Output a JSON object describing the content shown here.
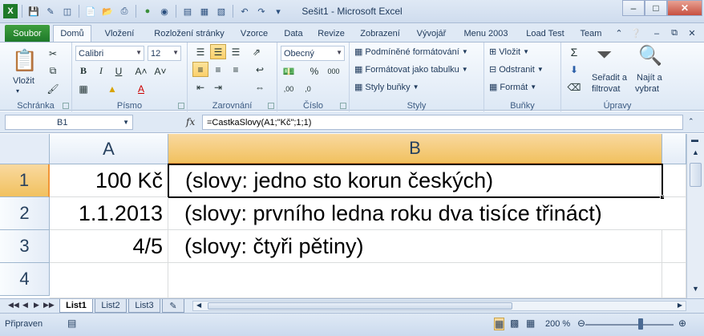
{
  "window": {
    "title": "Sešit1 - Microsoft Excel"
  },
  "ribbon": {
    "tabs": [
      "Soubor",
      "Domů",
      "Vložení",
      "Rozložení stránky",
      "Vzorce",
      "Data",
      "Revize",
      "Zobrazení",
      "Vývojář",
      "Menu 2003",
      "Load Test",
      "Team"
    ],
    "active_tab": "Domů",
    "clipboard": {
      "paste": "Vložit",
      "label": "Schránka"
    },
    "font": {
      "name": "Calibri",
      "size": "12",
      "label": "Písmo"
    },
    "alignment": {
      "label": "Zarovnání"
    },
    "number": {
      "format": "Obecný",
      "label": "Číslo"
    },
    "styles": {
      "conditional": "Podmíněné formátování",
      "table": "Formátovat jako tabulku",
      "cell": "Styly buňky",
      "label": "Styly"
    },
    "cells": {
      "insert": "Vložit",
      "delete": "Odstranit",
      "format": "Formát",
      "label": "Buňky"
    },
    "editing": {
      "sort1": "Seřadit a",
      "sort2": "filtrovat",
      "find1": "Najít a",
      "find2": "vybrat",
      "label": "Úpravy"
    }
  },
  "formula_bar": {
    "name_box": "B1",
    "fx": "fx",
    "formula": "=CastkaSlovy(A1;\"Kč\";1;1)"
  },
  "grid": {
    "columns": [
      "A",
      "B"
    ],
    "rows": [
      {
        "num": "1",
        "a": "100 Kč",
        "b": "(slovy: jedno sto korun českých)"
      },
      {
        "num": "2",
        "a": "1.1.2013",
        "b": "(slovy: prvního ledna roku dva tisíce třináct)"
      },
      {
        "num": "3",
        "a": "4/5",
        "b": "(slovy: čtyři pětiny)"
      },
      {
        "num": "4",
        "a": "",
        "b": ""
      }
    ]
  },
  "sheets": [
    "List1",
    "List2",
    "List3"
  ],
  "status": {
    "text": "Připraven",
    "zoom": "200 %"
  },
  "colors": {
    "accent": "#f29536",
    "file_tab": "#1e7a2a"
  }
}
